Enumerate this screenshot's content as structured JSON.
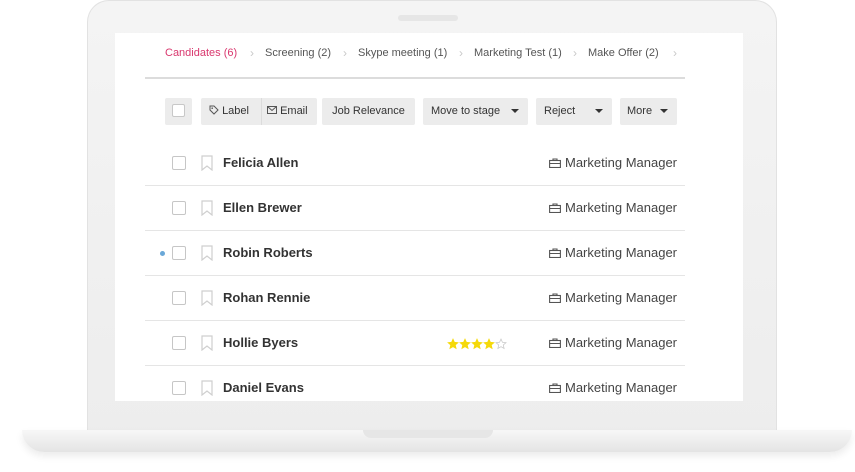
{
  "pipeline": {
    "stages": [
      {
        "label": "Candidates (6)",
        "active": true
      },
      {
        "label": "Screening (2)",
        "active": false
      },
      {
        "label": "Skype meeting (1)",
        "active": false
      },
      {
        "label": "Marketing Test (1)",
        "active": false
      },
      {
        "label": "Make Offer (2)",
        "active": false
      }
    ]
  },
  "toolbar": {
    "label_btn": "Label",
    "email_btn": "Email",
    "job_relevance_btn": "Job Relevance",
    "move_stage_btn": "Move to stage",
    "reject_btn": "Reject",
    "more_btn": "More"
  },
  "candidates": [
    {
      "name": "Felicia Allen",
      "job": "Marketing Manager",
      "rating": 0,
      "unread": false
    },
    {
      "name": "Ellen Brewer",
      "job": "Marketing Manager",
      "rating": 0,
      "unread": false
    },
    {
      "name": "Robin Roberts",
      "job": "Marketing Manager",
      "rating": 0,
      "unread": true
    },
    {
      "name": "Rohan Rennie",
      "job": "Marketing Manager",
      "rating": 0,
      "unread": false
    },
    {
      "name": "Hollie Byers",
      "job": "Marketing Manager",
      "rating": 4,
      "rating_max": 5,
      "unread": false
    },
    {
      "name": "Daniel Evans",
      "job": "Marketing Manager",
      "rating": 0,
      "unread": false
    }
  ],
  "colors": {
    "active_stage": "#d9376e",
    "star": "#f5d90a",
    "unread_dot": "#6aa8d8"
  },
  "icons": {
    "label": "tag-icon",
    "email": "envelope-icon",
    "job": "briefcase-icon",
    "bookmark": "bookmark-icon"
  }
}
